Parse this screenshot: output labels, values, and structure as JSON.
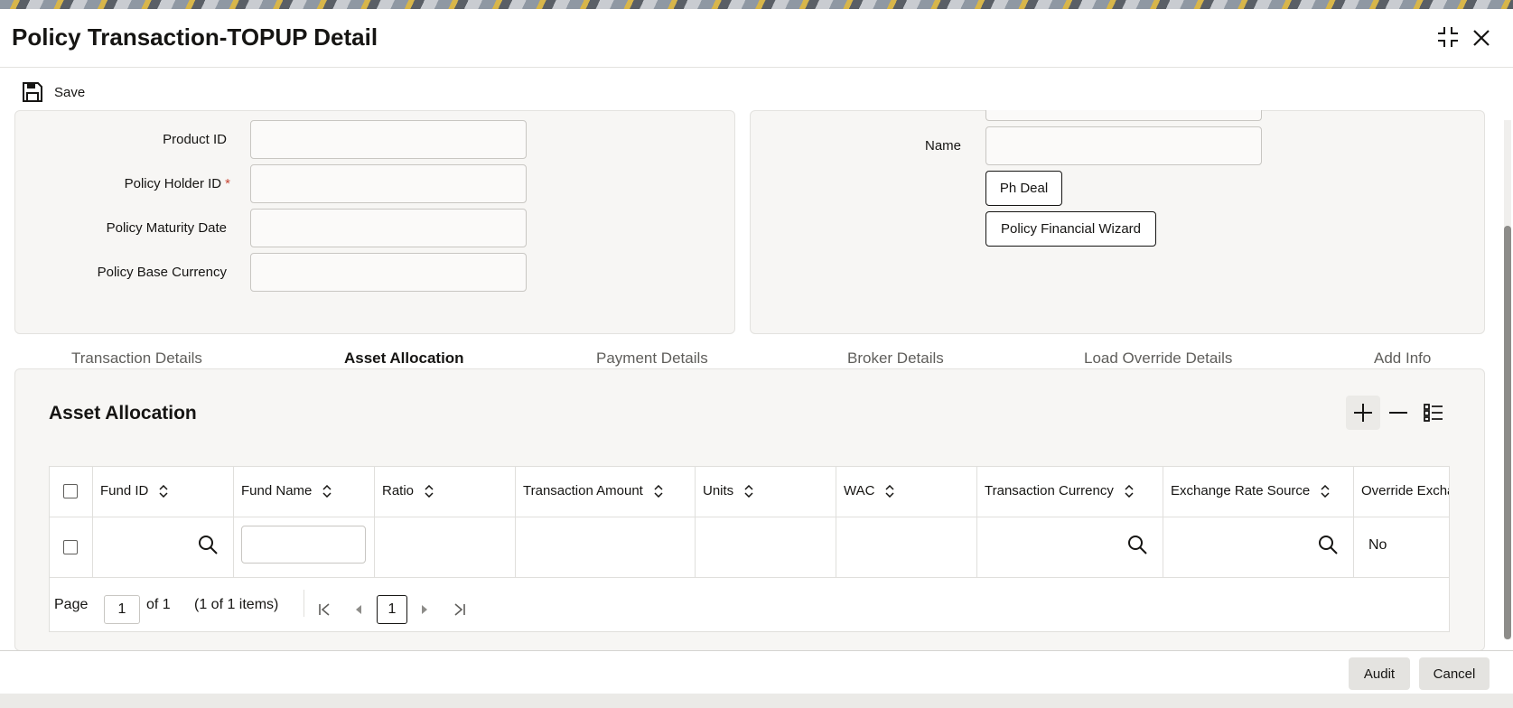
{
  "window": {
    "title": "Policy Transaction-TOPUP Detail"
  },
  "toolbar": {
    "save_label": "Save"
  },
  "form": {
    "product_id_label": "Product ID",
    "policy_holder_id_label": "Policy Holder ID",
    "required_mark": "*",
    "policy_maturity_date_label": "Policy Maturity Date",
    "policy_base_currency_label": "Policy Base Currency",
    "name_label": "Name",
    "ph_deal_button": "Ph Deal",
    "policy_financial_wizard_button": "Policy Financial Wizard"
  },
  "tabs": [
    {
      "label": "Transaction Details",
      "active": false
    },
    {
      "label": "Asset Allocation",
      "active": true
    },
    {
      "label": "Payment Details",
      "active": false
    },
    {
      "label": "Broker Details",
      "active": false
    },
    {
      "label": "Load Override Details",
      "active": false
    },
    {
      "label": "Add Info",
      "active": false
    }
  ],
  "asset_allocation": {
    "title": "Asset Allocation",
    "columns": [
      "Fund ID",
      "Fund Name",
      "Ratio",
      "Transaction Amount",
      "Units",
      "WAC",
      "Transaction Currency",
      "Exchange Rate Source",
      "Override Excha"
    ],
    "rows": [
      {
        "fund_id": "",
        "fund_name": "",
        "ratio": "",
        "transaction_amount": "",
        "units": "",
        "wac": "",
        "transaction_currency": "",
        "exchange_rate_source": "",
        "override_exchange": "No"
      }
    ],
    "pager": {
      "page_label": "Page",
      "current_page": "1",
      "of_label": "of 1",
      "items_label": "(1 of 1 items)",
      "page_button": "1"
    }
  },
  "footer": {
    "audit_label": "Audit",
    "cancel_label": "Cancel"
  },
  "colors": {
    "accent": "#3f5d7a",
    "required": "#c74634",
    "panel": "#f7f6f4"
  }
}
